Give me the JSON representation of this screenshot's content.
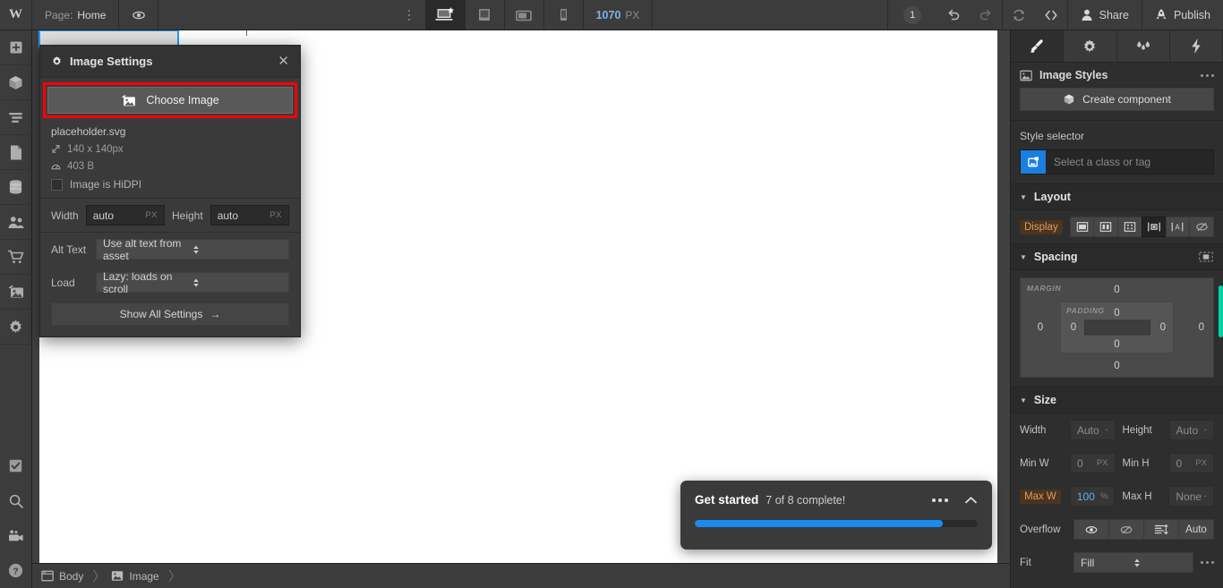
{
  "topbar": {
    "logo": "W",
    "page_label": "Page:",
    "page_name": "Home",
    "preview_icon": "eye-icon",
    "menu_icon": "more-vertical-icon",
    "breakpoints": [
      {
        "name": "desktop",
        "icon": "desktop-star-icon",
        "active": true
      },
      {
        "name": "tablet",
        "icon": "tablet-icon",
        "active": false
      },
      {
        "name": "tablet-landscape",
        "icon": "tablet-landscape-icon",
        "active": false
      },
      {
        "name": "mobile",
        "icon": "mobile-icon",
        "active": false
      }
    ],
    "viewport_width": "1070",
    "viewport_unit": "PX",
    "badge_count": "1",
    "undo_icon": "undo-icon",
    "redo_icon": "redo-icon",
    "refresh_icon": "refresh-icon",
    "code_icon": "code-brackets-icon",
    "share_label": "Share",
    "publish_label": "Publish"
  },
  "left_rail": {
    "items": [
      {
        "name": "add-elements",
        "icon": "plus-square-icon"
      },
      {
        "name": "components",
        "icon": "cube-icon"
      },
      {
        "name": "navigator",
        "icon": "layers-icon"
      },
      {
        "name": "pages",
        "icon": "document-icon"
      },
      {
        "name": "cms",
        "icon": "database-icon"
      },
      {
        "name": "users",
        "icon": "people-icon"
      },
      {
        "name": "ecommerce",
        "icon": "cart-icon"
      },
      {
        "name": "assets",
        "icon": "images-icon"
      },
      {
        "name": "settings",
        "icon": "gear-icon"
      }
    ],
    "bottom_items": [
      {
        "name": "audit",
        "icon": "checkbox-icon"
      },
      {
        "name": "search",
        "icon": "magnifier-icon"
      },
      {
        "name": "video-tutorials",
        "icon": "video-camera-icon"
      },
      {
        "name": "help",
        "icon": "question-circle-icon"
      }
    ]
  },
  "image_settings": {
    "title": "Image Settings",
    "title_icon": "gear-icon",
    "close_icon": "close-icon",
    "choose_button": "Choose Image",
    "choose_button_icon": "image-picker-icon",
    "highlight_color": "#ff0000",
    "file_name": "placeholder.svg",
    "dimensions": "140 x 140px",
    "dimensions_icon": "resize-diagonal-icon",
    "file_size": "403 B",
    "file_size_icon": "weight-icon",
    "hidpi_label": "Image is HiDPI",
    "hidpi_checked": false,
    "width_label": "Width",
    "width_value": "auto",
    "width_unit": "PX",
    "height_label": "Height",
    "height_value": "auto",
    "height_unit": "PX",
    "alt_label": "Alt Text",
    "alt_value": "Use alt text from asset",
    "load_label": "Load",
    "load_value": "Lazy: loads on scroll",
    "show_all": "Show All Settings",
    "show_all_arrow": "→"
  },
  "get_started": {
    "title": "Get started",
    "subtitle": "7 of 8 complete!",
    "progress_percent": 87.5,
    "progress_color": "#1a8cf0",
    "menu_icon": "more-horizontal-icon",
    "collapse_icon": "chevron-up-icon"
  },
  "right_panel": {
    "tabs": [
      {
        "name": "style",
        "icon": "brush-icon",
        "active": true
      },
      {
        "name": "settings",
        "icon": "gear-icon",
        "active": false
      },
      {
        "name": "interactions",
        "icon": "droplets-icon",
        "active": false
      },
      {
        "name": "effects",
        "icon": "lightning-icon",
        "active": false
      }
    ],
    "styles_header": "Image Styles",
    "styles_header_icon": "image-icon",
    "styles_menu_icon": "more-horizontal-icon",
    "create_component": "Create component",
    "create_component_icon": "cube-icon",
    "style_selector_label": "Style selector",
    "style_selector_placeholder": "Select a class or tag",
    "style_selector_icon": "element-image-icon",
    "style_selector_color": "#1a7fe0",
    "layout": {
      "title": "Layout",
      "display_label": "Display",
      "options": [
        {
          "name": "block",
          "icon": "display-block-icon",
          "active": false
        },
        {
          "name": "flex",
          "icon": "display-flex-icon",
          "active": false
        },
        {
          "name": "grid",
          "icon": "display-grid-icon",
          "active": false
        },
        {
          "name": "inline-block",
          "icon": "display-inline-block-icon",
          "active": true
        },
        {
          "name": "inline",
          "icon": "display-inline-icon",
          "active": false
        },
        {
          "name": "none",
          "icon": "display-none-icon",
          "active": false
        }
      ]
    },
    "spacing": {
      "title": "Spacing",
      "mode_icon": "spacing-mode-icon",
      "margin_label": "MARGIN",
      "padding_label": "PADDING",
      "margin_top": "0",
      "margin_right": "0",
      "margin_bottom": "0",
      "margin_left": "0",
      "padding_top": "0",
      "padding_right": "0",
      "padding_bottom": "0",
      "padding_left": "0"
    },
    "size": {
      "title": "Size",
      "width_label": "Width",
      "width_value": "Auto",
      "width_unit": "-",
      "height_label": "Height",
      "height_value": "Auto",
      "height_unit": "-",
      "minw_label": "Min W",
      "minw_value": "0",
      "minw_unit": "PX",
      "minh_label": "Min H",
      "minh_value": "0",
      "minh_unit": "PX",
      "maxw_label": "Max W",
      "maxw_value": "100",
      "maxw_unit": "%",
      "maxh_label": "Max H",
      "maxh_value": "None",
      "maxh_unit": "-",
      "overflow_label": "Overflow",
      "overflow_options": [
        {
          "name": "visible",
          "icon": "eye-icon"
        },
        {
          "name": "hidden",
          "icon": "eye-off-icon"
        },
        {
          "name": "scroll",
          "icon": "scroll-icon"
        },
        {
          "name": "auto",
          "icon": "text-auto",
          "label": "Auto"
        }
      ],
      "fit_label": "Fit",
      "fit_value": "Fill",
      "fit_menu_icon": "more-horizontal-icon"
    },
    "accent_highlight_color": "#e09b5a",
    "scrollbar_color": "#00d6a4"
  },
  "breadcrumb": {
    "items": [
      {
        "label": "Body",
        "icon": "browser-icon"
      },
      {
        "label": "Image",
        "icon": "image-icon"
      }
    ],
    "separator": "〉"
  }
}
